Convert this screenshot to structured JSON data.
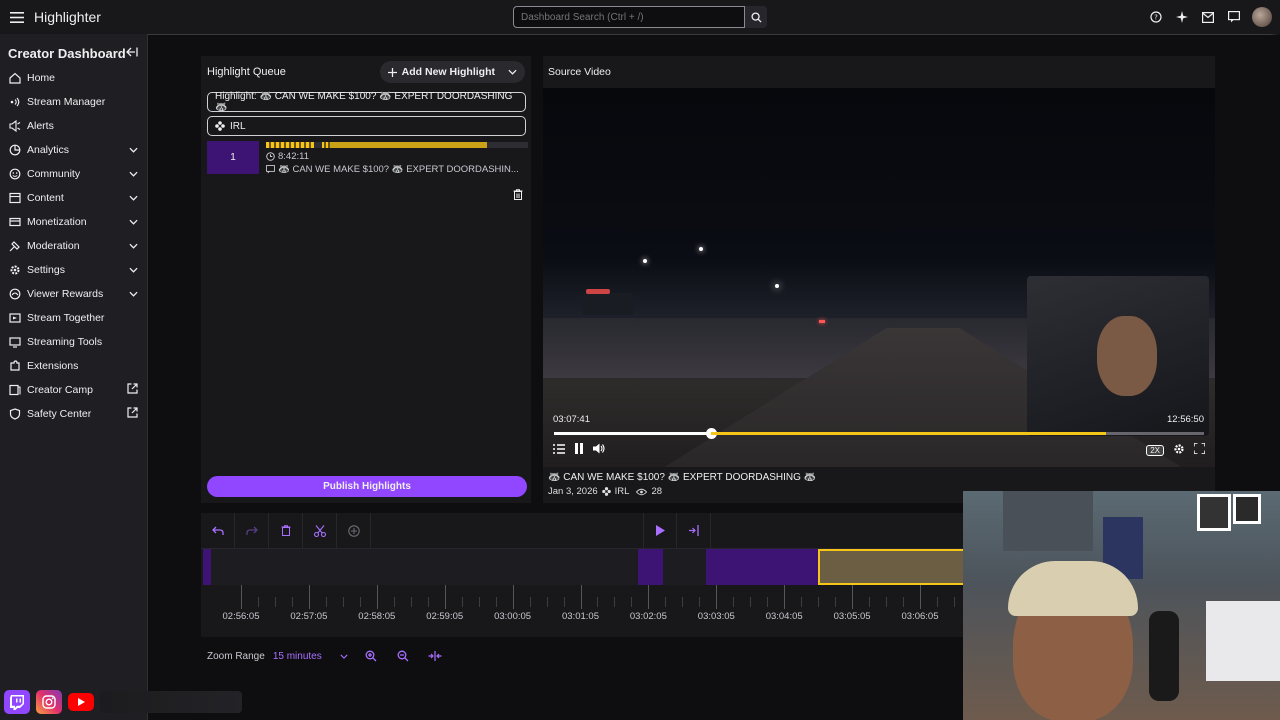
{
  "app": {
    "title": "Highlighter"
  },
  "search": {
    "placeholder": "Dashboard Search (Ctrl + /)"
  },
  "sidebar": {
    "title": "Creator Dashboard",
    "items": [
      {
        "label": "Home",
        "icon": "home-icon",
        "expandable": false,
        "external": false
      },
      {
        "label": "Stream Manager",
        "icon": "stream-manager-icon",
        "expandable": false,
        "external": false
      },
      {
        "label": "Alerts",
        "icon": "alerts-icon",
        "expandable": false,
        "external": false
      },
      {
        "label": "Analytics",
        "icon": "analytics-icon",
        "expandable": true,
        "external": false
      },
      {
        "label": "Community",
        "icon": "community-icon",
        "expandable": true,
        "external": false
      },
      {
        "label": "Content",
        "icon": "content-icon",
        "expandable": true,
        "external": false
      },
      {
        "label": "Monetization",
        "icon": "monetization-icon",
        "expandable": true,
        "external": false
      },
      {
        "label": "Moderation",
        "icon": "moderation-icon",
        "expandable": true,
        "external": false
      },
      {
        "label": "Settings",
        "icon": "settings-icon",
        "expandable": true,
        "external": false
      },
      {
        "label": "Viewer Rewards",
        "icon": "viewer-rewards-icon",
        "expandable": true,
        "external": false
      },
      {
        "label": "Stream Together",
        "icon": "stream-together-icon",
        "expandable": false,
        "external": false
      },
      {
        "label": "Streaming Tools",
        "icon": "streaming-tools-icon",
        "expandable": false,
        "external": false
      },
      {
        "label": "Extensions",
        "icon": "extensions-icon",
        "expandable": false,
        "external": false
      },
      {
        "label": "Creator Camp",
        "icon": "creator-camp-icon",
        "expandable": false,
        "external": true
      },
      {
        "label": "Safety Center",
        "icon": "safety-center-icon",
        "expandable": false,
        "external": true
      }
    ]
  },
  "queue": {
    "title": "Highlight Queue",
    "add_label": "Add New Highlight",
    "highlight_title": "Highlight: 🦝 CAN WE MAKE $100? 🦝 EXPERT DOORDASHING 🦝",
    "category": "IRL",
    "items": [
      {
        "number": "1",
        "duration": "8:42:11",
        "title": "🦝 CAN WE MAKE $100? 🦝 EXPERT DOORDASHIN..."
      }
    ],
    "publish_label": "Publish Highlights"
  },
  "video": {
    "header": "Source Video",
    "current_time": "03:07:41",
    "total_time": "12:56:50",
    "progress": 0.242,
    "speed": "2X",
    "title": "🦝 CAN WE MAKE $100? 🦝 EXPERT DOORDASHING 🦝",
    "date": "Jan 3, 2026",
    "category": "IRL",
    "views": "28"
  },
  "timeline": {
    "ticks": [
      "02:56:05",
      "02:57:05",
      "02:58:05",
      "02:59:05",
      "03:00:05",
      "03:01:05",
      "03:02:05",
      "03:03:05",
      "03:04:05",
      "03:05:05",
      "03:06:05"
    ]
  },
  "zoom": {
    "label": "Zoom Range",
    "value": "15 minutes"
  },
  "colors": {
    "accent": "#9147ff",
    "accent_text": "#a970ff",
    "highlight_yellow": "#f5c518",
    "selection": "#3d1473"
  }
}
